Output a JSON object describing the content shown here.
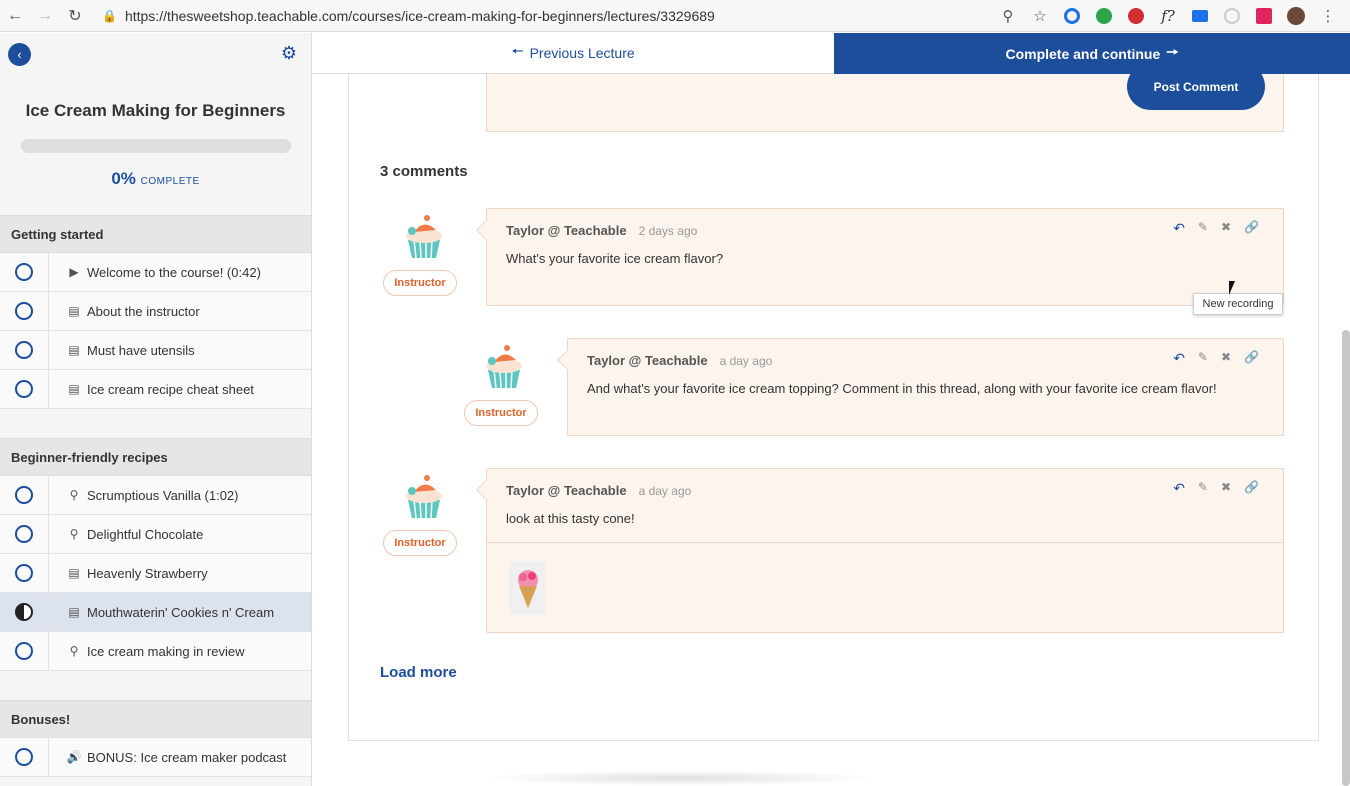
{
  "browser": {
    "url": "https://thesweetshop.teachable.com/courses/ice-cream-making-for-beginners/lectures/3329689"
  },
  "sidebar": {
    "course_title": "Ice Cream Making for Beginners",
    "progress_percent": "0%",
    "progress_label": "COMPLETE",
    "sections": [
      {
        "title": "Getting started",
        "items": [
          {
            "label": "Welcome to the course! (0:42)",
            "icon": "video-icon",
            "status": "incomplete"
          },
          {
            "label": "About the instructor",
            "icon": "document-icon",
            "status": "incomplete"
          },
          {
            "label": "Must have utensils",
            "icon": "document-icon",
            "status": "incomplete"
          },
          {
            "label": "Ice cream recipe cheat sheet",
            "icon": "document-icon",
            "status": "incomplete"
          }
        ]
      },
      {
        "title": "Beginner-friendly recipes",
        "items": [
          {
            "label": "Scrumptious Vanilla (1:02)",
            "icon": "lightbulb-icon",
            "status": "incomplete"
          },
          {
            "label": "Delightful Chocolate",
            "icon": "lightbulb-icon",
            "status": "incomplete"
          },
          {
            "label": "Heavenly Strawberry",
            "icon": "document-icon",
            "status": "incomplete"
          },
          {
            "label": "Mouthwaterin' Cookies n' Cream",
            "icon": "document-icon",
            "status": "in-progress"
          },
          {
            "label": "Ice cream making in review",
            "icon": "lightbulb-icon",
            "status": "incomplete"
          }
        ]
      },
      {
        "title": "Bonuses!",
        "items": [
          {
            "label": "BONUS: Ice cream maker podcast",
            "icon": "audio-icon",
            "status": "incomplete"
          }
        ]
      }
    ]
  },
  "lecture_nav": {
    "previous_label": "Previous Lecture",
    "next_label": "Complete and continue"
  },
  "comments": {
    "post_button": "Post Comment",
    "count_label": "3 comments",
    "items": [
      {
        "author": "Taylor @ Teachable",
        "time": "2 days ago",
        "body": "What's your favorite ice cream flavor?",
        "badge": "Instructor"
      },
      {
        "author": "Taylor @ Teachable",
        "time": "a day ago",
        "body": "And what's your favorite ice cream topping? Comment in this thread, along with your favorite ice cream flavor!",
        "badge": "Instructor"
      },
      {
        "author": "Taylor @ Teachable",
        "time": "a day ago",
        "body": "look at this tasty cone!",
        "badge": "Instructor"
      }
    ],
    "load_more": "Load more"
  },
  "tooltip": "New recording",
  "colors": {
    "brand": "#1c4e9c",
    "comment_bg": "#fdf4ee",
    "instructor_badge": "#e0622a"
  }
}
